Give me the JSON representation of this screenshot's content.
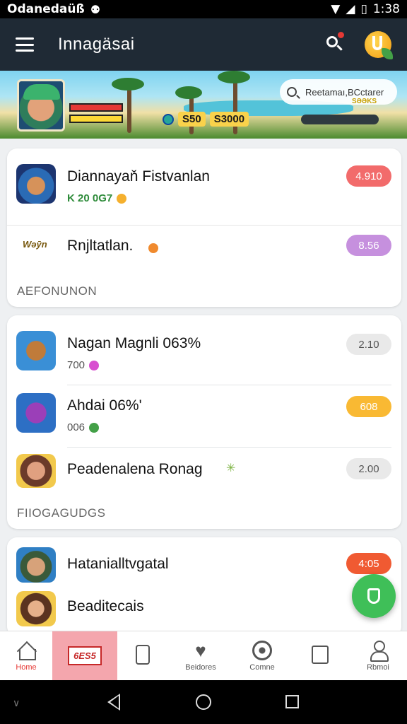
{
  "status_bar": {
    "carrier": "Odanedaüß",
    "time": "1:38"
  },
  "app_bar": {
    "title": "Innagäsai"
  },
  "banner": {
    "coins_a": "S50",
    "coins_b": "S3000",
    "search_text": "Reetamaı,BCctarer",
    "search_sub": "SƏƏKS"
  },
  "card1": {
    "items": [
      {
        "title": "Diannayaň Fistvanlan",
        "meta": "K   20  0G7",
        "price": "4.910",
        "price_color": "#f26b6b"
      },
      {
        "title": "Rnjltatlan.",
        "logo_text": "Wəȳn",
        "price": "8.56",
        "price_color": "#c690de"
      }
    ],
    "section_label": "AEFONUNON"
  },
  "card2": {
    "items": [
      {
        "title": "Nagan Magnli 063%",
        "meta": "700",
        "price": "2.10",
        "price_color": "#e9e9e9"
      },
      {
        "title": "Ahdai 06%'",
        "meta": "006",
        "price": "608",
        "price_color": "#f9b933"
      },
      {
        "title": "Peadenalena Ronag",
        "price": "2.00",
        "price_color": "#e9e9e9"
      }
    ],
    "section_label": "FIIOGAGUDGS"
  },
  "card3": {
    "items": [
      {
        "title": "Hatanialltvgatal",
        "price": "4:05",
        "price_color": "#f05a32"
      },
      {
        "title": "Beaditecais"
      }
    ]
  },
  "bottom_nav": {
    "items": [
      {
        "label": "Home"
      },
      {
        "label": "6ES5"
      },
      {
        "label": ""
      },
      {
        "label": "Beidores"
      },
      {
        "label": "Comne"
      },
      {
        "label": ""
      },
      {
        "label": "Rbmoi"
      }
    ]
  },
  "colors": {
    "app_bar": "#1f2a35",
    "accent_red": "#e53935",
    "fab": "#3fbf58"
  }
}
